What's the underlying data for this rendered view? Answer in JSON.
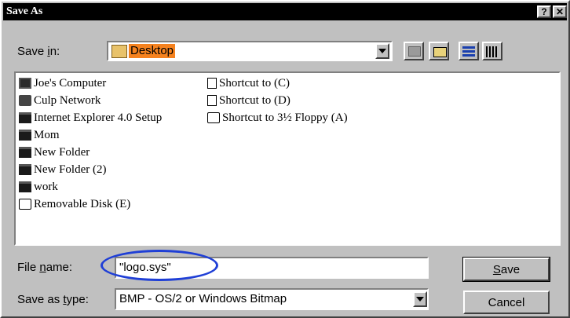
{
  "window": {
    "title": "Save As",
    "help_label": "?",
    "close_label": "✕"
  },
  "save_in": {
    "label_pre": "Save ",
    "label_key": "i",
    "label_post": "n:",
    "value": "Desktop"
  },
  "toolbar": {
    "up_icon": "up-folder-icon",
    "new_folder_icon": "new-folder-icon",
    "list_icon": "list-view-icon",
    "details_icon": "details-view-icon"
  },
  "files": {
    "col1": [
      {
        "name": "Joe's Computer",
        "icon": "computer-icon"
      },
      {
        "name": "Culp Network",
        "icon": "network-icon"
      },
      {
        "name": "Internet Explorer 4.0 Setup",
        "icon": "folder-icon"
      },
      {
        "name": "Mom",
        "icon": "folder-icon"
      },
      {
        "name": "New Folder",
        "icon": "folder-icon"
      },
      {
        "name": "New Folder (2)",
        "icon": "folder-icon"
      },
      {
        "name": "work",
        "icon": "folder-icon"
      },
      {
        "name": "Removable Disk (E)",
        "icon": "drive-icon"
      }
    ],
    "col2": [
      {
        "name": "Shortcut to (C)",
        "icon": "shortcut-icon"
      },
      {
        "name": "Shortcut to (D)",
        "icon": "shortcut-icon"
      },
      {
        "name": "Shortcut to 3½ Floppy (A)",
        "icon": "floppy-icon"
      }
    ]
  },
  "filename": {
    "label_pre": "File ",
    "label_key": "n",
    "label_post": "ame:",
    "value": "\"logo.sys\""
  },
  "filetype": {
    "label_pre": "Save as ",
    "label_key": "t",
    "label_post": "ype:",
    "value": "BMP - OS/2 or Windows Bitmap"
  },
  "buttons": {
    "save_key": "S",
    "save_rest": "ave",
    "cancel": "Cancel"
  },
  "colors": {
    "highlight": "#f5821f",
    "annotation": "#1f3fd6"
  }
}
